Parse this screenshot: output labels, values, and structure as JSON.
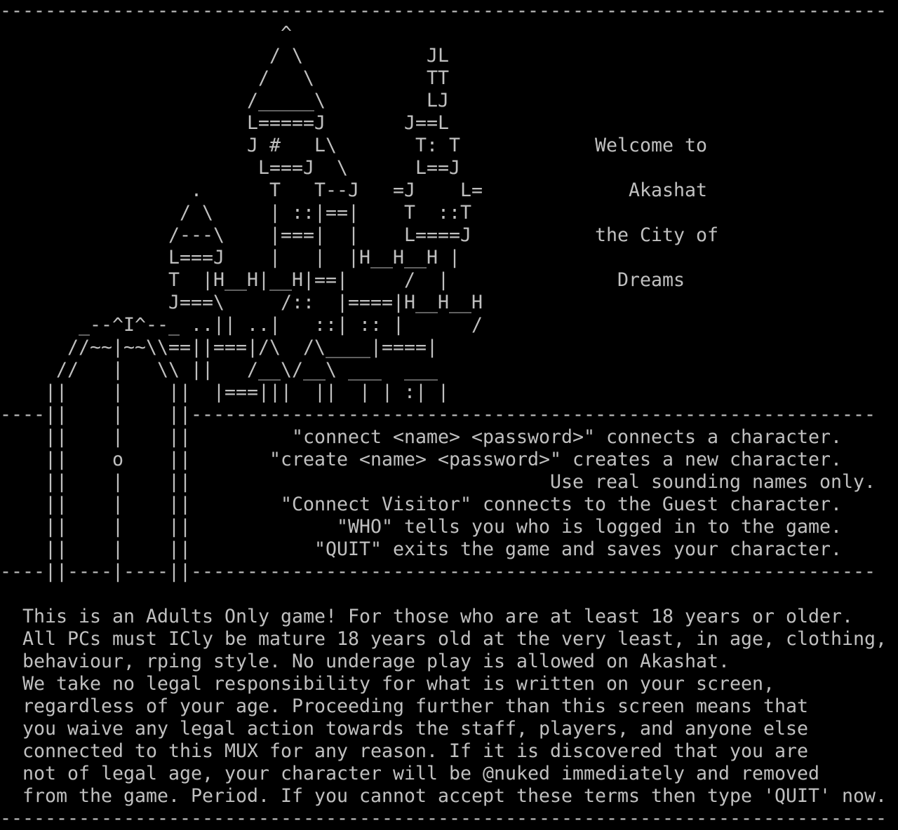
{
  "terminal": {
    "foreground": "#c0c0c0",
    "background": "#000000",
    "columns": 80,
    "lines": [
      "-------------------------------------------------------------------------------",
      "                         ^",
      "                        / \\           JL",
      "                       /   \\          TT",
      "                      /_____\\         LJ",
      "                      L=====J       J==L",
      "                      J #   L\\       T: T            Welcome to",
      "                       L===J  \\      L==J",
      "                 .      T   T--J   =J    L=             Akashat",
      "                / \\     | ::|==|    T  ::T",
      "               /---\\    |===|  |    L====J           the City of",
      "               L===J    |   |  |H__H__H |",
      "               T  |H__H|__H|==|     /  |               Dreams",
      "               J===\\     /::  |====|H__H__H",
      "       _--^I^--_ ..|| ..|   ::| :: |      /",
      "      //~~|~~\\\\==||===|/\\  /\\____|====|",
      "     //   |   \\\\ ||   /__\\/__\\ ___  ___",
      "    ||    |    ||  |===|||  ||  | | :| |",
      "----||    |    ||-------------------------------------------------------------",
      "    ||    |    ||         \"connect <name> <password>\" connects a character.",
      "    ||    o    ||       \"create <name> <password>\" creates a new character.",
      "    ||    |    ||                                Use real sounding names only.",
      "    ||    |    ||        \"Connect Visitor\" connects to the Guest character.",
      "    ||    |    ||             \"WHO\" tells you who is logged in to the game.",
      "    ||    |    ||           \"QUIT\" exits the game and saves your character.",
      "----||----|----||-------------------------------------------------------------",
      "",
      "  This is an Adults Only game! For those who are at least 18 years or older.",
      "  All PCs must ICly be mature 18 years old at the very least, in age, clothing,",
      "  behaviour, rping style. No underage play is allowed on Akashat.",
      "  We take no legal responsibility for what is written on your screen,",
      "  regardless of your age. Proceeding further than this screen means that",
      "  you waive any legal action towards the staff, players, and anyone else",
      "  connected to this MUX for any reason. If it is discovered that you are",
      "  not of legal age, your character will be @nuked immediately and removed",
      "  from the game. Period. If you cannot accept these terms then type 'QUIT' now.",
      "-------------------------------------------------------------------------------"
    ]
  }
}
